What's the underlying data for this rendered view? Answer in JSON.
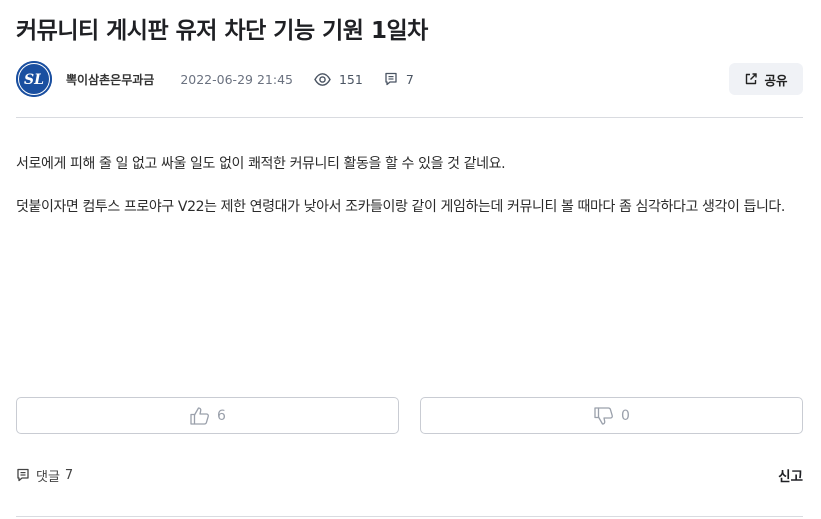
{
  "post": {
    "title": "커뮤니티 게시판 유저 차단 기능 기원 1일차",
    "author": "뽁이삼촌은무과금",
    "avatar_text": "SL",
    "date": "2022-06-29 21:45",
    "views": "151",
    "comment_count": "7",
    "share_label": "공유",
    "paragraphs": [
      "서로에게 피해 줄 일 없고 싸울 일도 없이 쾌적한 커뮤니티 활동을 할 수 있을 것 같네요.",
      "덧붙이자면 컴투스 프로야구 V22는 제한 연령대가 낮아서 조카들이랑 같이 게임하는데 커뮤니티 볼 때마다 좀 심각하다고 생각이 듭니다."
    ],
    "likes": "6",
    "dislikes": "0",
    "comments_label": "댓글",
    "comments_value": "7",
    "report_label": "신고"
  },
  "colors": {
    "avatar_bg": "#1a4fa0",
    "share_bg": "#f0f2f6",
    "divider": "#d9dbe0"
  }
}
